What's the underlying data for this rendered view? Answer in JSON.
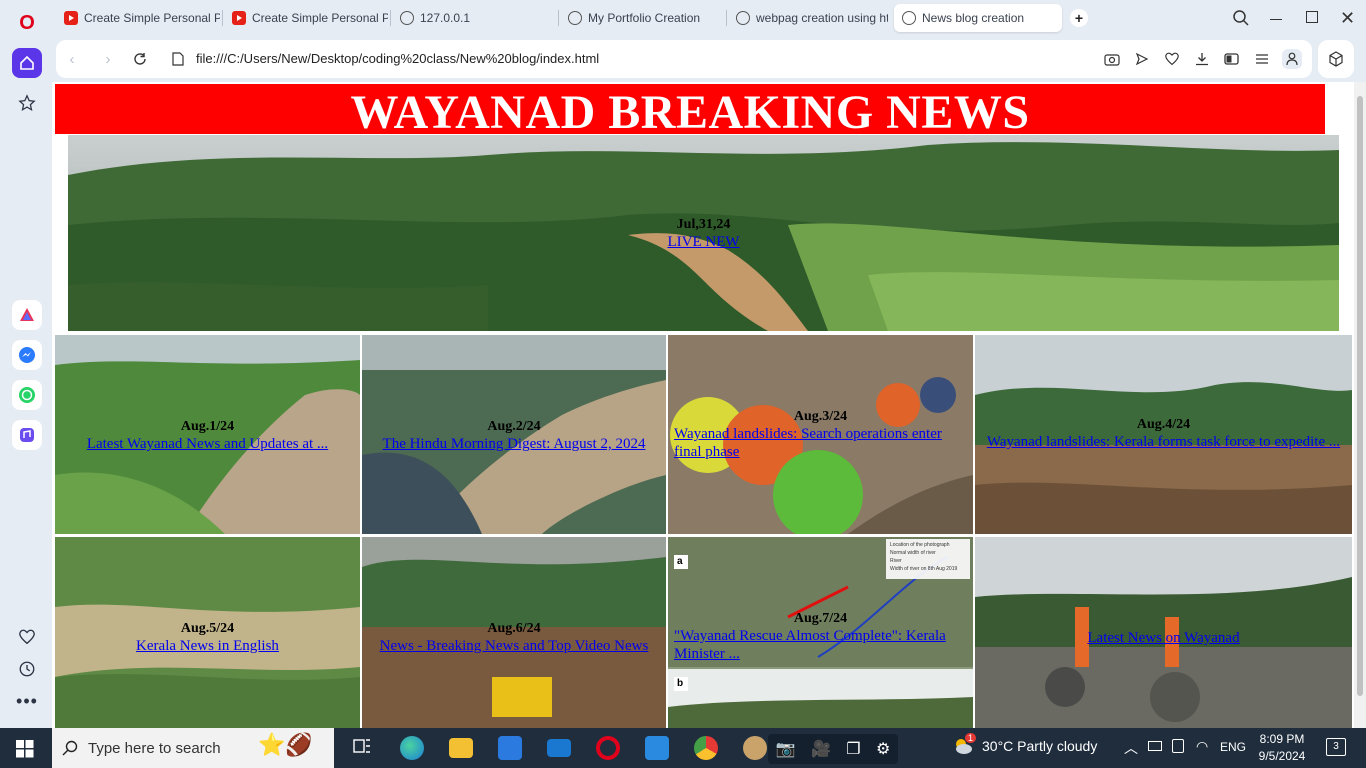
{
  "browser": {
    "tabs": [
      {
        "title": "Create Simple Personal Po",
        "icon": "youtube-icon",
        "active": false
      },
      {
        "title": "Create Simple Personal Po",
        "icon": "youtube-icon",
        "active": false
      },
      {
        "title": "127.0.0.1",
        "icon": "globe-icon",
        "active": false
      },
      {
        "title": "My Portfolio Creation",
        "icon": "globe-icon",
        "active": false
      },
      {
        "title": "webpag creation using htm",
        "icon": "globe-icon",
        "active": false
      },
      {
        "title": "News blog creation",
        "icon": "globe-icon",
        "active": true
      }
    ],
    "new_tab_symbol": "+",
    "url": "file:///C:/Users/New/Desktop/coding%20class/New%20blog/index.html"
  },
  "page": {
    "banner_title": "WAYANAD BREAKING NEWS",
    "hero": {
      "date": "Jul,31,24",
      "link": "LIVE NEW"
    },
    "news": [
      {
        "date": "Aug.1/24",
        "link": "Latest Wayanad News and Updates at ..."
      },
      {
        "date": "Aug.2/24",
        "link": "The Hindu Morning Digest: August 2, 2024"
      },
      {
        "date": "Aug.3/24",
        "link": "Wayanad landslides: Search operations enter final phase"
      },
      {
        "date": "Aug.4/24",
        "link": "Wayanad landslides: Kerala forms task force to expedite ..."
      },
      {
        "date": "Aug.5/24",
        "link": "Kerala News in English"
      },
      {
        "date": "Aug.6/24",
        "link": "News - Breaking News and Top Video News"
      },
      {
        "date": "Aug.7/24",
        "link": "\"Wayanad Rescue Almost Complete\": Kerala Minister ..."
      },
      {
        "date": "",
        "link": "Latest News on Wayanad"
      }
    ]
  },
  "map_legend": [
    "Location of the photograph",
    "Normal width of river",
    "River",
    "Width of river on 8th Aug 2019"
  ],
  "map_labels": [
    "a",
    "b"
  ],
  "taskbar": {
    "search_placeholder": "Type here to search",
    "weather": "30°C  Partly cloudy",
    "language": "ENG",
    "time": "8:09 PM",
    "date": "9/5/2024",
    "notifications": "3",
    "weather_badge": "1"
  }
}
